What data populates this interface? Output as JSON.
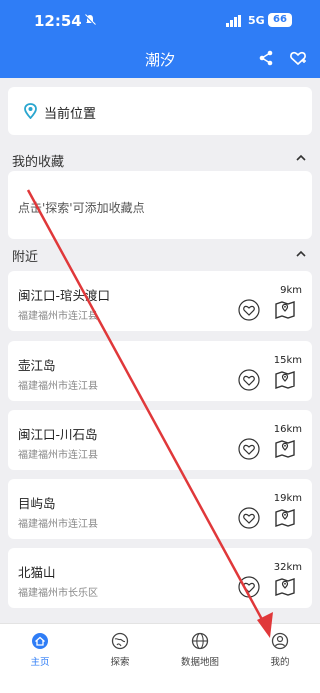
{
  "status_bar": {
    "time": "12:54",
    "network": "5G",
    "battery": "66"
  },
  "app_bar": {
    "title": "潮汐"
  },
  "location": {
    "label": "当前位置"
  },
  "favorites": {
    "title": "我的收藏",
    "empty_hint": "点击'探索'可添加收藏点"
  },
  "nearby": {
    "title": "附近",
    "items": [
      {
        "name": "闽江口-琯头渡口",
        "region": "福建福州市连江县",
        "distance": "9km"
      },
      {
        "name": "壶江岛",
        "region": "福建福州市连江县",
        "distance": "15km"
      },
      {
        "name": "闽江口-川石岛",
        "region": "福建福州市连江县",
        "distance": "16km"
      },
      {
        "name": "目屿岛",
        "region": "福建福州市连江县",
        "distance": "19km"
      },
      {
        "name": "北猫山",
        "region": "福建福州市长乐区",
        "distance": "32km"
      }
    ]
  },
  "tabs": [
    {
      "label": "主页",
      "icon": "home-icon",
      "active": true
    },
    {
      "label": "探索",
      "icon": "explore-icon",
      "active": false
    },
    {
      "label": "数据地图",
      "icon": "globe-icon",
      "active": false
    },
    {
      "label": "我的",
      "icon": "user-icon",
      "active": false
    }
  ],
  "colors": {
    "primary": "#2f7df6",
    "annotation_arrow": "#e0383a"
  }
}
